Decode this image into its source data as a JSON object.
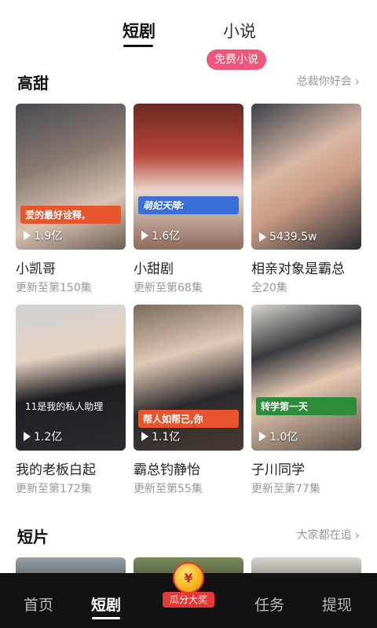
{
  "top_tabs": {
    "active": "短剧",
    "second": "小说",
    "badge": "免费小说"
  },
  "section1": {
    "title": "高甜",
    "more": "总裁你好会"
  },
  "section2": {
    "title": "短片",
    "more": "大家都在追"
  },
  "cards": [
    {
      "title": "小凯哥",
      "sub": "更新至第150集",
      "plays": "1.9亿",
      "caption": "爱的最好诠释,",
      "caption_color": "#e8542b"
    },
    {
      "title": "小甜剧",
      "sub": "更新至第68集",
      "plays": "1.6亿",
      "caption": "萌妃天降:",
      "caption_color": "#3a6fd8"
    },
    {
      "title": "相亲对象是霸总",
      "sub": "全20集",
      "plays": "5439.5w",
      "caption": "",
      "caption_color": ""
    },
    {
      "title": "我的老板白起",
      "sub": "更新至第172集",
      "plays": "1.2亿",
      "caption": "11是我的私人助理",
      "caption_color": ""
    },
    {
      "title": "霸总钓静怡",
      "sub": "更新至第55集",
      "plays": "1.1亿",
      "caption": "帮人如帮己,你",
      "caption_color": "#e8542b"
    },
    {
      "title": "子川同学",
      "sub": "更新至第77集",
      "plays": "1.0亿",
      "caption": "转学第一天",
      "caption_color": "#2e8b3a"
    }
  ],
  "bottom_nav": {
    "home": "首页",
    "drama": "短剧",
    "reward": "瓜分大奖",
    "coin": "¥",
    "tasks": "任务",
    "withdraw": "提现"
  },
  "colors": {
    "accent": "#f0557a",
    "nav_bg": "#121212",
    "reward": "#e53935"
  }
}
